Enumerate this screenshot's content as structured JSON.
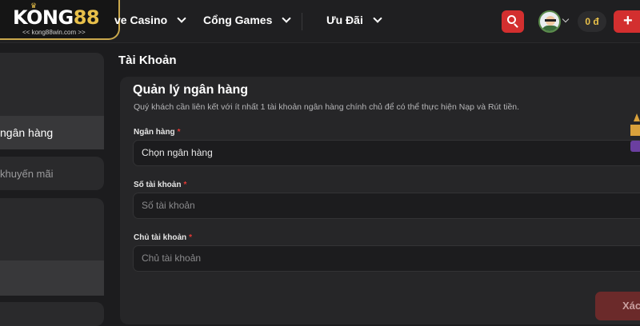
{
  "header": {
    "logo_text_white": "KONG",
    "logo_text_gold": "88",
    "logo_subtitle": "<< kong88win.com >>",
    "nav": [
      {
        "label": "ve Casino"
      },
      {
        "label": "Cổng Games"
      },
      {
        "label": "Ưu Đãi"
      }
    ],
    "balance": "0 đ",
    "plus_label": "+"
  },
  "sidebar": {
    "items": [
      {
        "label": "ngân hàng",
        "active": true
      },
      {
        "label": "khuyến mãi",
        "active": false
      }
    ]
  },
  "main": {
    "page_title": "Tài Khoản",
    "panel_title": "Quản lý ngân hàng",
    "panel_description": "Quý khách cần liên kết với ít nhất 1 tài khoản ngân hàng chính chủ để có thể thực hiện Nạp và Rút tiền.",
    "fields": [
      {
        "label": "Ngân hàng",
        "required": "*",
        "value": "Chọn ngân hàng",
        "type": "select"
      },
      {
        "label": "Số tài khoản",
        "required": "*",
        "placeholder": "Số tài khoản",
        "type": "input"
      },
      {
        "label": "Chủ tài khoản",
        "required": "*",
        "placeholder": "Chủ tài khoản",
        "type": "input"
      }
    ],
    "confirm_label": "Xác"
  },
  "colors": {
    "accent_red": "#d32f2f",
    "gold": "#e8c04a",
    "background": "#1c1c1e"
  },
  "icons": [
    "search-icon",
    "avatar",
    "chevron-down-icon",
    "plus-icon"
  ]
}
